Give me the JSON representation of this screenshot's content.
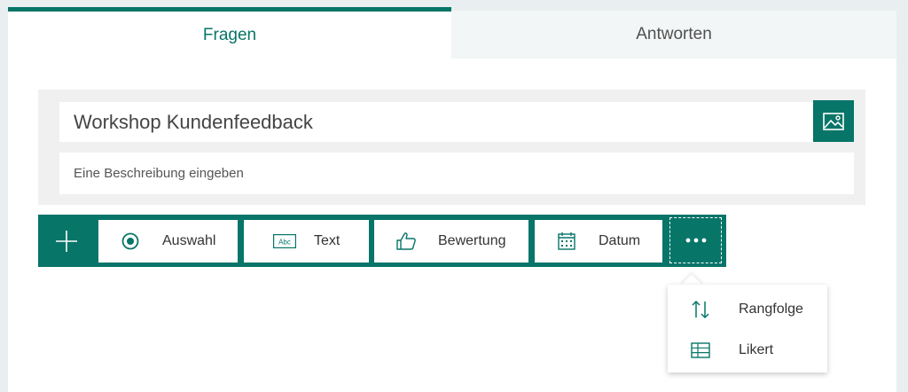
{
  "tabs": {
    "questions": "Fragen",
    "responses": "Antworten"
  },
  "form": {
    "title": "Workshop Kundenfeedback",
    "description_placeholder": "Eine Beschreibung eingeben"
  },
  "toolbar": {
    "choice": "Auswahl",
    "text": "Text",
    "text_icon_label": "Abc",
    "rating": "Bewertung",
    "date": "Datum"
  },
  "more_menu": {
    "ranking": "Rangfolge",
    "likert": "Likert"
  },
  "colors": {
    "accent": "#077568",
    "background": "#e9eef0"
  },
  "icons": {
    "image": "image-icon",
    "add": "plus-icon",
    "choice": "radio-icon",
    "text": "text-box-icon",
    "rating": "thumbs-up-icon",
    "date": "calendar-icon",
    "more": "ellipsis-icon",
    "ranking": "sort-arrows-icon",
    "likert": "grid-table-icon"
  }
}
